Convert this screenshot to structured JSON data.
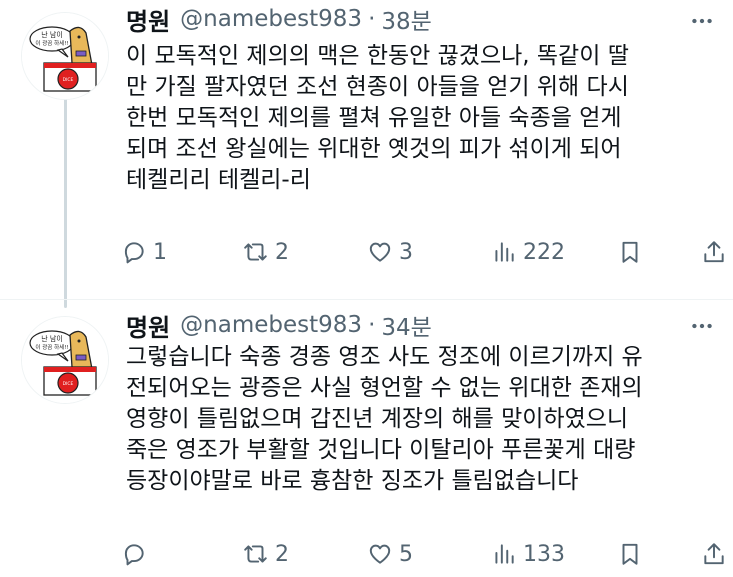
{
  "tweets": [
    {
      "name": "명원",
      "handle": "@namebest983",
      "dot": "·",
      "time": "38분",
      "text": "이 모독적인 제의의 맥은 한동안 끊겼으나, 똑같이 딸\n만 가질 팔자였던 조선 현종이 아들을 얻기 위해 다시\n한번 모독적인 제의를 펼쳐 유일한 아들 숙종을 얻게\n되며 조선 왕실에는 위대한 옛것의 피가 섞이게 되어\n테켈리리 테켈리-리",
      "replies": "1",
      "retweets": "2",
      "likes": "3",
      "views": "222",
      "avatar_text": "난 남이\n이 광끔 하세!!"
    },
    {
      "name": "명원",
      "handle": "@namebest983",
      "dot": "·",
      "time": "34분",
      "text": "그렇습니다 숙종 경종 영조 사도 정조에 이르기까지 유\n전되어오는 광증은 사실 형언할 수 없는 위대한 존재의\n영향이 틀림없으며 갑진년 계장의 해를 맞이하였으니\n죽은 영조가 부활할 것입니다 이탈리아 푸른꽃게 대량\n등장이야말로 바로 흉참한 징조가 틀림없습니다",
      "replies": "",
      "retweets": "2",
      "likes": "5",
      "views": "133",
      "avatar_text": "난 남이\n이 광끔 하세!!"
    }
  ],
  "icons": {
    "reply": "reply-icon",
    "retweet": "retweet-icon",
    "like": "heart-icon",
    "views": "views-chart-icon",
    "bookmark": "bookmark-icon",
    "share": "share-icon",
    "more": "more-dots-icon"
  },
  "colors": {
    "text": "#0f1419",
    "secondary": "#536471",
    "divider": "#eff3f4",
    "thread_line": "#cfd9de",
    "avatar_red": "#e02020"
  }
}
